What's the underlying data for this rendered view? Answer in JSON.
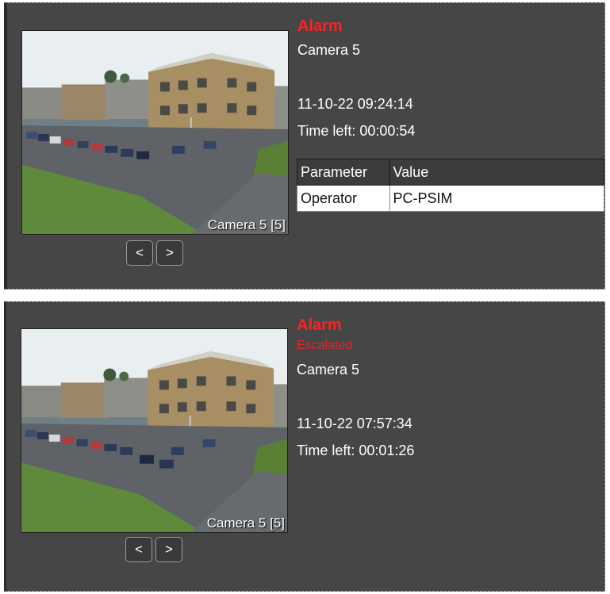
{
  "alarms": [
    {
      "title": "Alarm",
      "camera": "Camera 5",
      "timestamp": "11-10-22 09:24:14",
      "time_left": "Time left: 00:00:54",
      "video_label": "Camera 5 [5]",
      "prev_label": "<",
      "next_label": ">",
      "table": {
        "headers": [
          "Parameter",
          "Value"
        ],
        "rows": [
          [
            "Operator",
            "PC-PSIM"
          ]
        ]
      }
    },
    {
      "title": "Alarm",
      "status": "Escalated",
      "camera": "Camera 5",
      "timestamp": "11-10-22 07:57:34",
      "time_left": "Time left: 00:01:26",
      "video_label": "Camera 5 [5]",
      "prev_label": "<",
      "next_label": ">"
    }
  ],
  "colors": {
    "panel_bg": "#464646",
    "alarm_red": "#ff2020",
    "text": "#ffffff"
  }
}
